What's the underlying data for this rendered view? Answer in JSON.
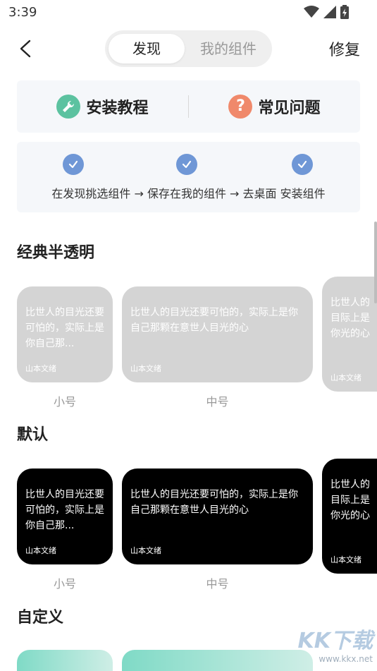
{
  "status_bar": {
    "time": "3:39"
  },
  "nav": {
    "tabs": [
      {
        "label": "发现"
      },
      {
        "label": "我的组件"
      }
    ],
    "action": "修复"
  },
  "help_card": {
    "tutorial": "安装教程",
    "faq": "常见问题"
  },
  "steps_card": {
    "text": "在发现挑选组件 → 保存在我的组件 → 去桌面 安装组件"
  },
  "sections": [
    {
      "title": "经典半透明",
      "widgets": [
        {
          "text": "比世人的目光还要可怕的，实际上是你自己那...",
          "author": "山本文绪",
          "size": "小号"
        },
        {
          "text": "比世人的目光还要可怕的，实际上是你自己那颗在意世人目光的心",
          "author": "山本文绪",
          "size": "中号"
        },
        {
          "text": "比世人的目际上是你光的心",
          "author": "山本文绪"
        }
      ]
    },
    {
      "title": "默认",
      "widgets": [
        {
          "text": "比世人的目光还要可怕的，实际上是你自己那...",
          "author": "山本文绪",
          "size": "小号"
        },
        {
          "text": "比世人的目光还要可怕的，实际上是你自己那颗在意世人目光的心",
          "author": "山本文绪",
          "size": "中号"
        },
        {
          "text": "比世人的目际上是你光的心",
          "author": "山本文绪"
        }
      ]
    },
    {
      "title": "自定义"
    }
  ],
  "watermark": {
    "main": "KK下载",
    "sub": "www.kkx.net"
  },
  "colors": {
    "accent_check": "#6f97d6",
    "tutorial_icon": "#5cc2a0",
    "faq_icon": "#f0896b"
  }
}
